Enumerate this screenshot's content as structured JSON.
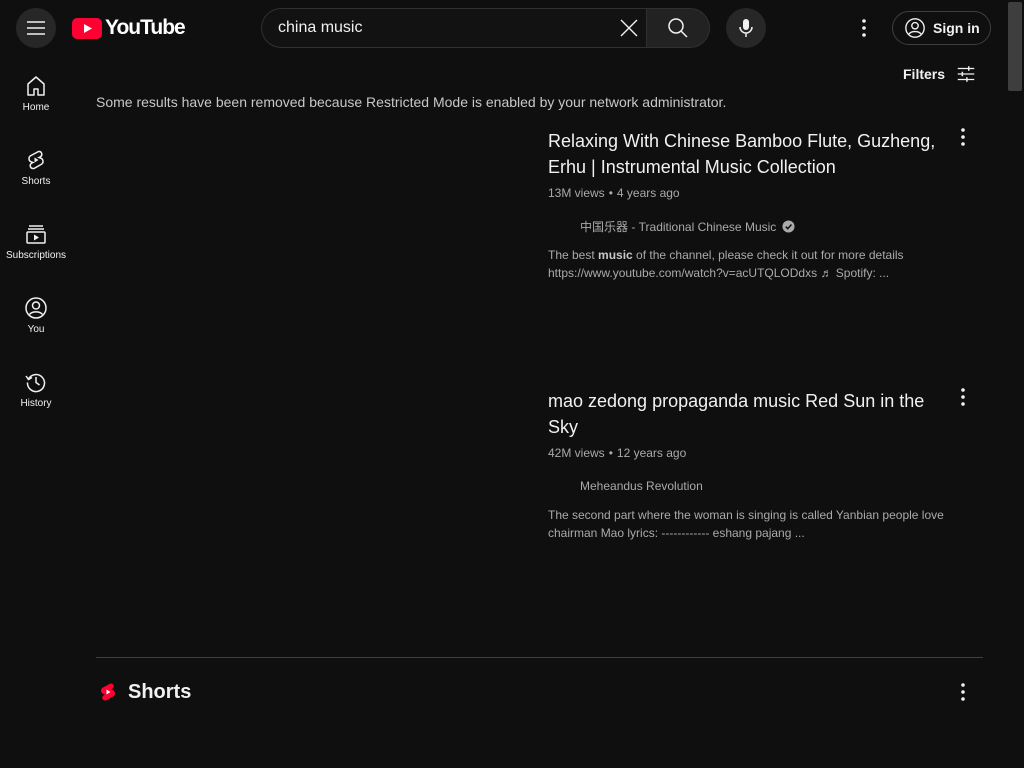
{
  "header": {
    "logo_text": "YouTube",
    "search_value": "china music",
    "signin_label": "Sign in"
  },
  "sidebar": {
    "items": [
      {
        "label": "Home",
        "icon": "home-icon"
      },
      {
        "label": "Shorts",
        "icon": "shorts-icon"
      },
      {
        "label": "Subscriptions",
        "icon": "subscriptions-icon"
      },
      {
        "label": "You",
        "icon": "you-icon"
      },
      {
        "label": "History",
        "icon": "history-icon"
      }
    ]
  },
  "filters_label": "Filters",
  "notice": "Some results have been removed because Restricted Mode is enabled by your network administrator.",
  "results": [
    {
      "title": "Relaxing With Chinese Bamboo Flute, Guzheng, Erhu | Instrumental Music Collection",
      "views": "13M views",
      "age": "4 years ago",
      "channel": "中国乐器 - Traditional Chinese Music",
      "verified": true,
      "desc_before": "The best ",
      "desc_bold": "music",
      "desc_after": " of the channel, please check it out for more details https://www.youtube.com/watch?v=acUTQLODdxs ♬ Spotify: ..."
    },
    {
      "title": "mao zedong propaganda music Red Sun in the Sky",
      "views": "42M views",
      "age": "12 years ago",
      "channel": "Meheandus Revolution",
      "verified": false,
      "desc_before": "The second part where the woman is singing is called Yanbian people love chairman Mao lyrics: ------------ eshang pajang ...",
      "desc_bold": "",
      "desc_after": ""
    }
  ],
  "shorts_title": "Shorts",
  "colors": {
    "background": "#0f0f0f",
    "brand_red": "#ff0033",
    "text": "#f1f1f1",
    "muted": "#aaaaaa"
  }
}
